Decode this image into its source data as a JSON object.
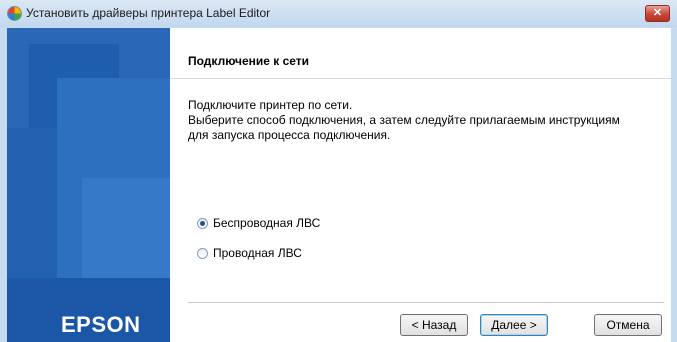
{
  "window": {
    "title": "Установить драйверы принтера Label Editor",
    "close_label": "✕"
  },
  "sidebar": {
    "brand": "EPSON"
  },
  "main": {
    "heading": "Подключение к сети",
    "description_lines": [
      "Подключите принтер по сети.",
      "Выберите способ подключения, а затем следуйте прилагаемым инструкциям",
      "для запуска процесса подключения."
    ],
    "options": [
      {
        "label": "Беспроводная ЛВС",
        "selected": true
      },
      {
        "label": "Проводная ЛВС",
        "selected": false
      }
    ]
  },
  "footer": {
    "back_label": "< Назад",
    "next_label": "Далее >",
    "cancel_label": "Отмена"
  }
}
